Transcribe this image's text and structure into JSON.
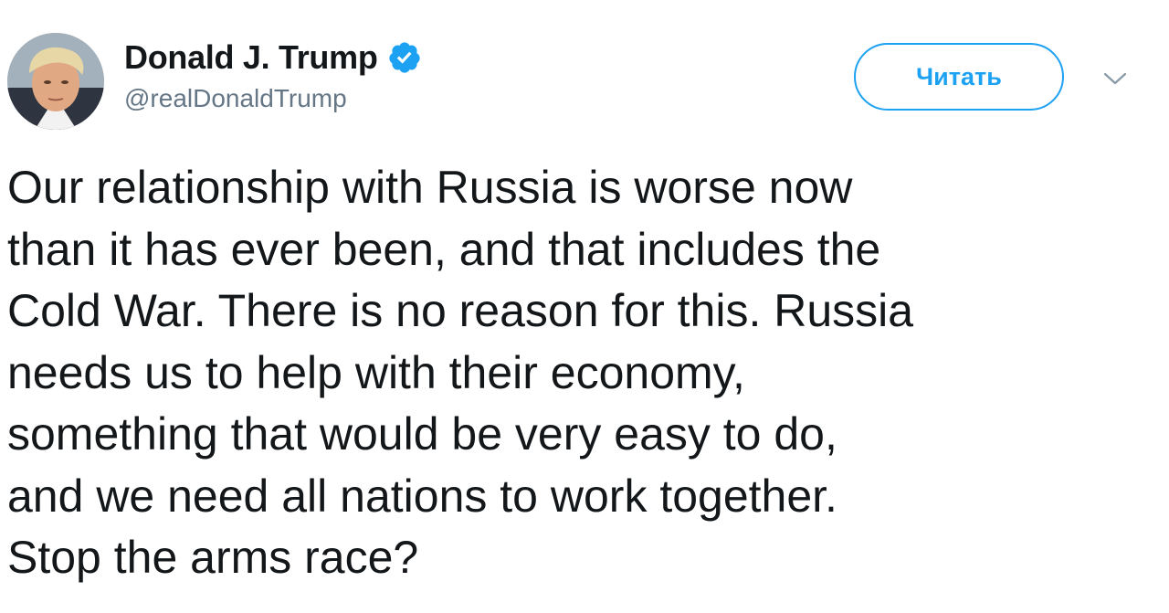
{
  "author": {
    "display_name": "Donald J. Trump",
    "handle": "@realDonaldTrump",
    "verified": true,
    "avatar_icon": "user-avatar-photo"
  },
  "actions": {
    "follow_label": "Читать",
    "menu_icon": "chevron-down-icon"
  },
  "tweet": {
    "text": "Our relationship with Russia is worse now\nthan it has ever been, and that includes the\nCold War. There is no reason for this. Russia\nneeds us to help with their economy,\nsomething that would be very easy to do,\nand we need all nations to work together.\nStop the arms race?"
  },
  "colors": {
    "accent": "#1da1f2",
    "text": "#14171a",
    "secondary_text": "#657786",
    "background": "#ffffff"
  }
}
